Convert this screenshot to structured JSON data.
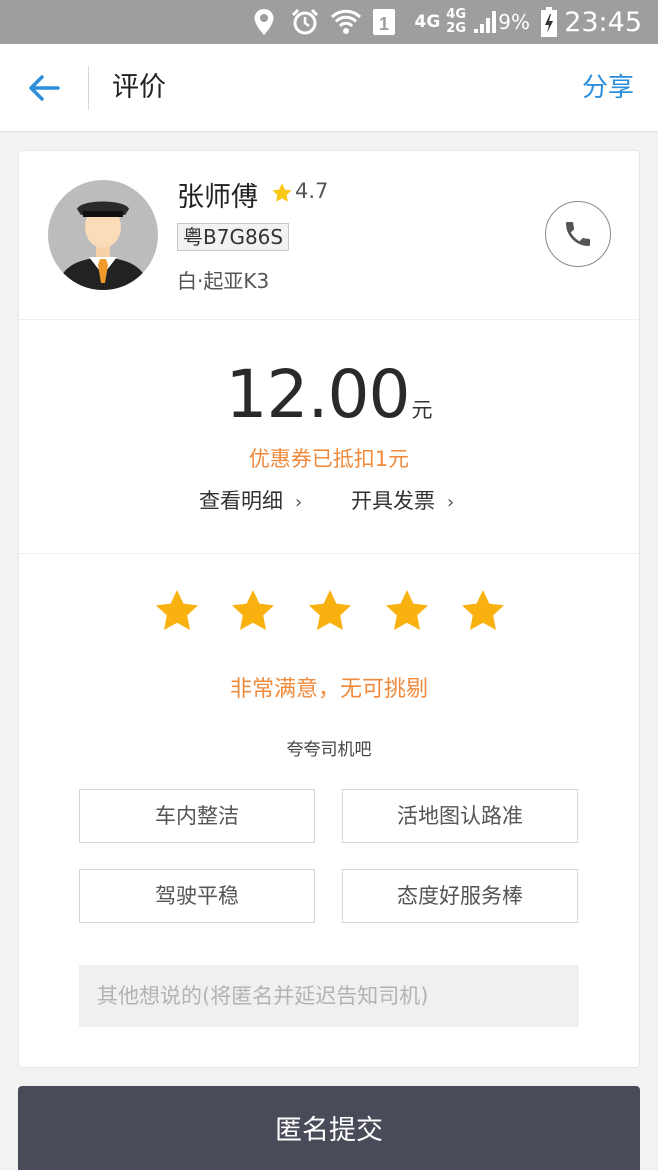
{
  "status_bar": {
    "time": "23:45",
    "battery_percent": "9%",
    "network_top": "4G 4G",
    "network_bottom": "2G",
    "sim_slot": "1",
    "icons": [
      "location-icon",
      "alarm-icon",
      "wifi-icon",
      "sim-icon",
      "signal-icon",
      "battery-charging-icon"
    ]
  },
  "header": {
    "title": "评价",
    "share_label": "分享",
    "back_icon": "arrow-left-icon",
    "accent_color": "#2d8fdc"
  },
  "driver": {
    "name": "张师傅",
    "rating": "4.7",
    "plate": "粤B7G86S",
    "car": "白·起亚K3",
    "avatar_icon": "driver-avatar-icon",
    "phone_icon": "phone-icon"
  },
  "fare": {
    "amount": "12.00",
    "unit": "元",
    "coupon_note": "优惠券已抵扣1元",
    "detail_link": "查看明细",
    "invoice_link": "开具发票"
  },
  "rating": {
    "stars_selected": 5,
    "stars_total": 5,
    "star_color": "#f9b10f",
    "feedback_text": "非常满意，无可挑剔",
    "praise_label": "夸夸司机吧",
    "tags": [
      "车内整洁",
      "活地图认路准",
      "驾驶平稳",
      "态度好服务棒"
    ],
    "comment_placeholder": "其他想说的(将匿名并延迟告知司机)"
  },
  "submit": {
    "label": "匿名提交"
  },
  "colors": {
    "orange": "#f08a3c",
    "button_dark": "#4a4b59"
  }
}
